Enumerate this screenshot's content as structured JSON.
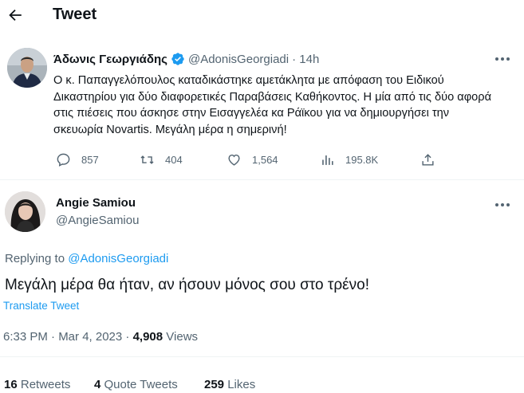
{
  "header": {
    "title": "Tweet"
  },
  "tweet1": {
    "author_name": "Άδωνις Γεωργιάδης",
    "author_handle": "@AdonisGeorgiadi",
    "time_ago": "· 14h",
    "text": "Ο κ. Παπαγγελόπουλος καταδικάστηκε αμετάκλητα με απόφαση του Ειδικού Δικαστηρίου για δύο διαφορετικές Παραβάσεις Καθήκοντος. Η μία από τις δύο αφορά στις πιέσεις που άσκησε στην Εισαγγελέα κα Ράϊκου για να δημιουργήσει την σκευωρία Novartis. Μεγάλη μέρα η σημερινή!",
    "actions": {
      "replies": "857",
      "retweets": "404",
      "likes": "1,564",
      "views": "195.8K"
    },
    "verified_color": "#1d9bf0"
  },
  "tweet2": {
    "author_name": "Angie Samiou",
    "author_handle": "@AngieSamiou",
    "replying_to_label": "Replying to",
    "replying_to_handle": "@AdonisGeorgiadi",
    "text": "Μεγάλη μέρα θα ήταν, αν ήσουν μόνος σου στο τρένο!",
    "translate_label": "Translate Tweet",
    "timestamp": "6:33 PM · Mar 4, 2023 · ",
    "views_count": "4,908",
    "views_label": " Views",
    "stats": {
      "retweets_count": "16",
      "retweets_label": " Retweets",
      "quotes_count": "4",
      "quotes_label": " Quote Tweets",
      "likes_count": "259",
      "likes_label": " Likes"
    }
  },
  "colors": {
    "accent": "#1d9bf0",
    "secondary_text": "#536471",
    "primary_text": "#0f1419"
  }
}
